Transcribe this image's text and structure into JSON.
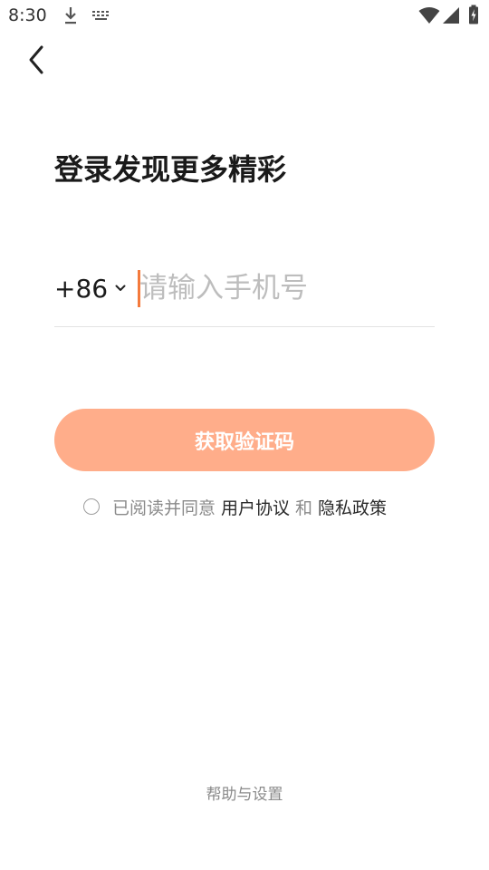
{
  "status_bar": {
    "time": "8:30",
    "icons": [
      "download-icon",
      "keyboard-icon",
      "wifi-icon",
      "signal-icon",
      "battery-icon"
    ]
  },
  "header": {
    "back_icon": "chevron-left-icon"
  },
  "title": "登录发现更多精彩",
  "phone": {
    "country_code": "+86",
    "placeholder": "请输入手机号",
    "value": ""
  },
  "get_code_button": {
    "label": "获取验证码",
    "color": "#ffad8a"
  },
  "agreement": {
    "prefix": "已阅读并同意",
    "user_agreement": "用户协议",
    "and": "和",
    "privacy_policy": "隐私政策",
    "checked": false
  },
  "footer": {
    "help_label": "帮助与设置"
  },
  "colors": {
    "accent": "#f47a3c",
    "button_bg": "#ffad8a"
  }
}
